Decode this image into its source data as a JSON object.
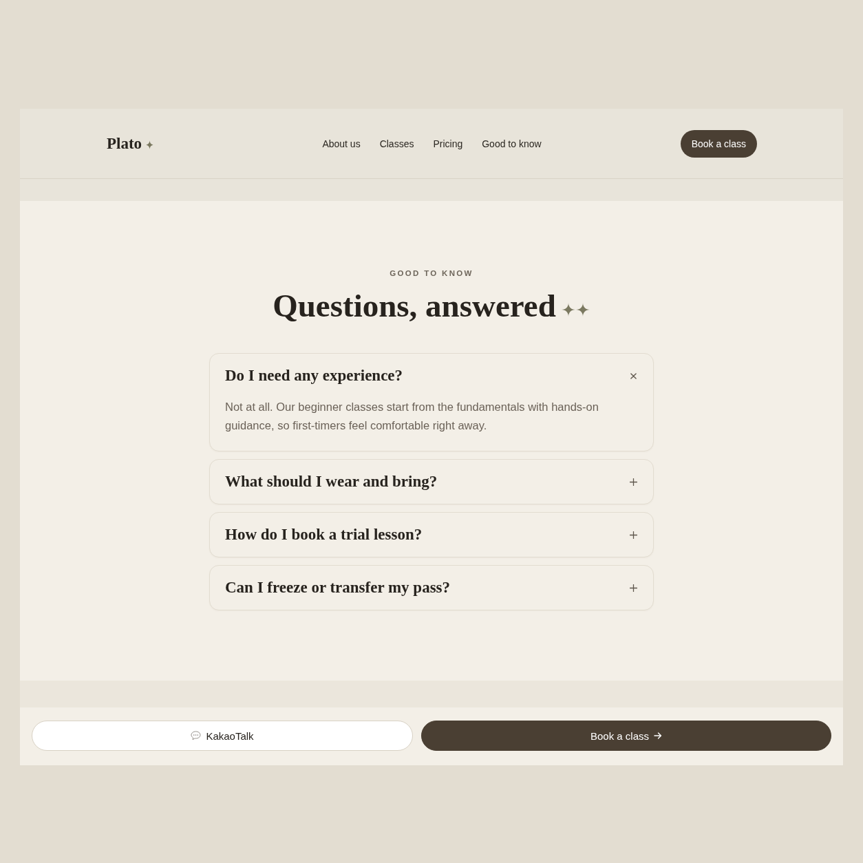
{
  "header": {
    "logo": "Plato",
    "nav": [
      "About us",
      "Classes",
      "Pricing",
      "Good to know"
    ],
    "cta": "Book a class"
  },
  "faq": {
    "eyebrow": "GOOD TO KNOW",
    "title": "Questions, answered",
    "items": [
      {
        "question": "Do I need any experience?",
        "answer": "Not at all. Our beginner classes start from the fundamentals with hands-on guidance, so first-timers feel comfortable right away.",
        "expanded": true
      },
      {
        "question": "What should I wear and bring?",
        "expanded": false
      },
      {
        "question": "How do I book a trial lesson?",
        "expanded": false
      },
      {
        "question": "Can I freeze or transfer my pass?",
        "expanded": false
      }
    ]
  },
  "bottom_bar": {
    "buttons": [
      {
        "kind": "secondary",
        "label": "KakaoTalk"
      },
      {
        "kind": "primary",
        "label": "Book a class"
      }
    ]
  }
}
